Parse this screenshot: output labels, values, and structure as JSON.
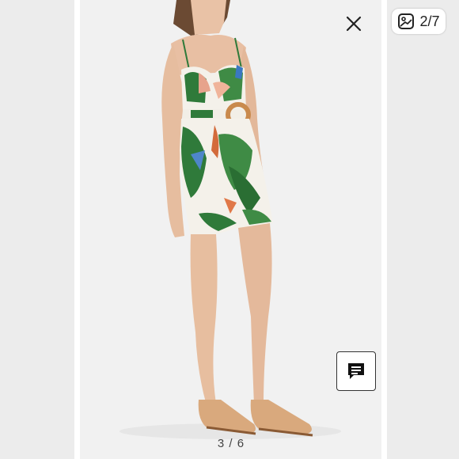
{
  "gallery": {
    "counter_text": "2/7",
    "page_indicator": "3 / 6",
    "icons": {
      "close": "close-icon",
      "gallery": "image-gallery-icon",
      "chat": "chat-comment-icon"
    }
  },
  "colors": {
    "panel_bg": "#ececec",
    "main_bg": "#f0f0f0",
    "accent_green": "#2f7a3a",
    "dress_base": "#f4f1ea",
    "sandal": "#b98550"
  }
}
